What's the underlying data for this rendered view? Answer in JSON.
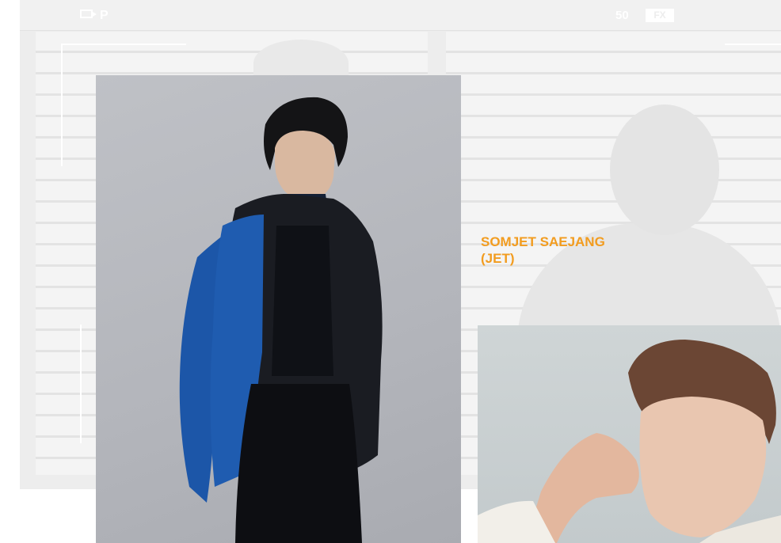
{
  "viewfinder": {
    "mode_label": "P",
    "fps_label": "50",
    "fx_label": "FX"
  },
  "photos": {
    "main": {
      "icon": "portrait-photo"
    },
    "secondary": {
      "icon": "portrait-photo"
    }
  },
  "caption": {
    "line1": "SOMJET SAEJANG",
    "line2": "(JET)",
    "color": "#f29c1f"
  }
}
